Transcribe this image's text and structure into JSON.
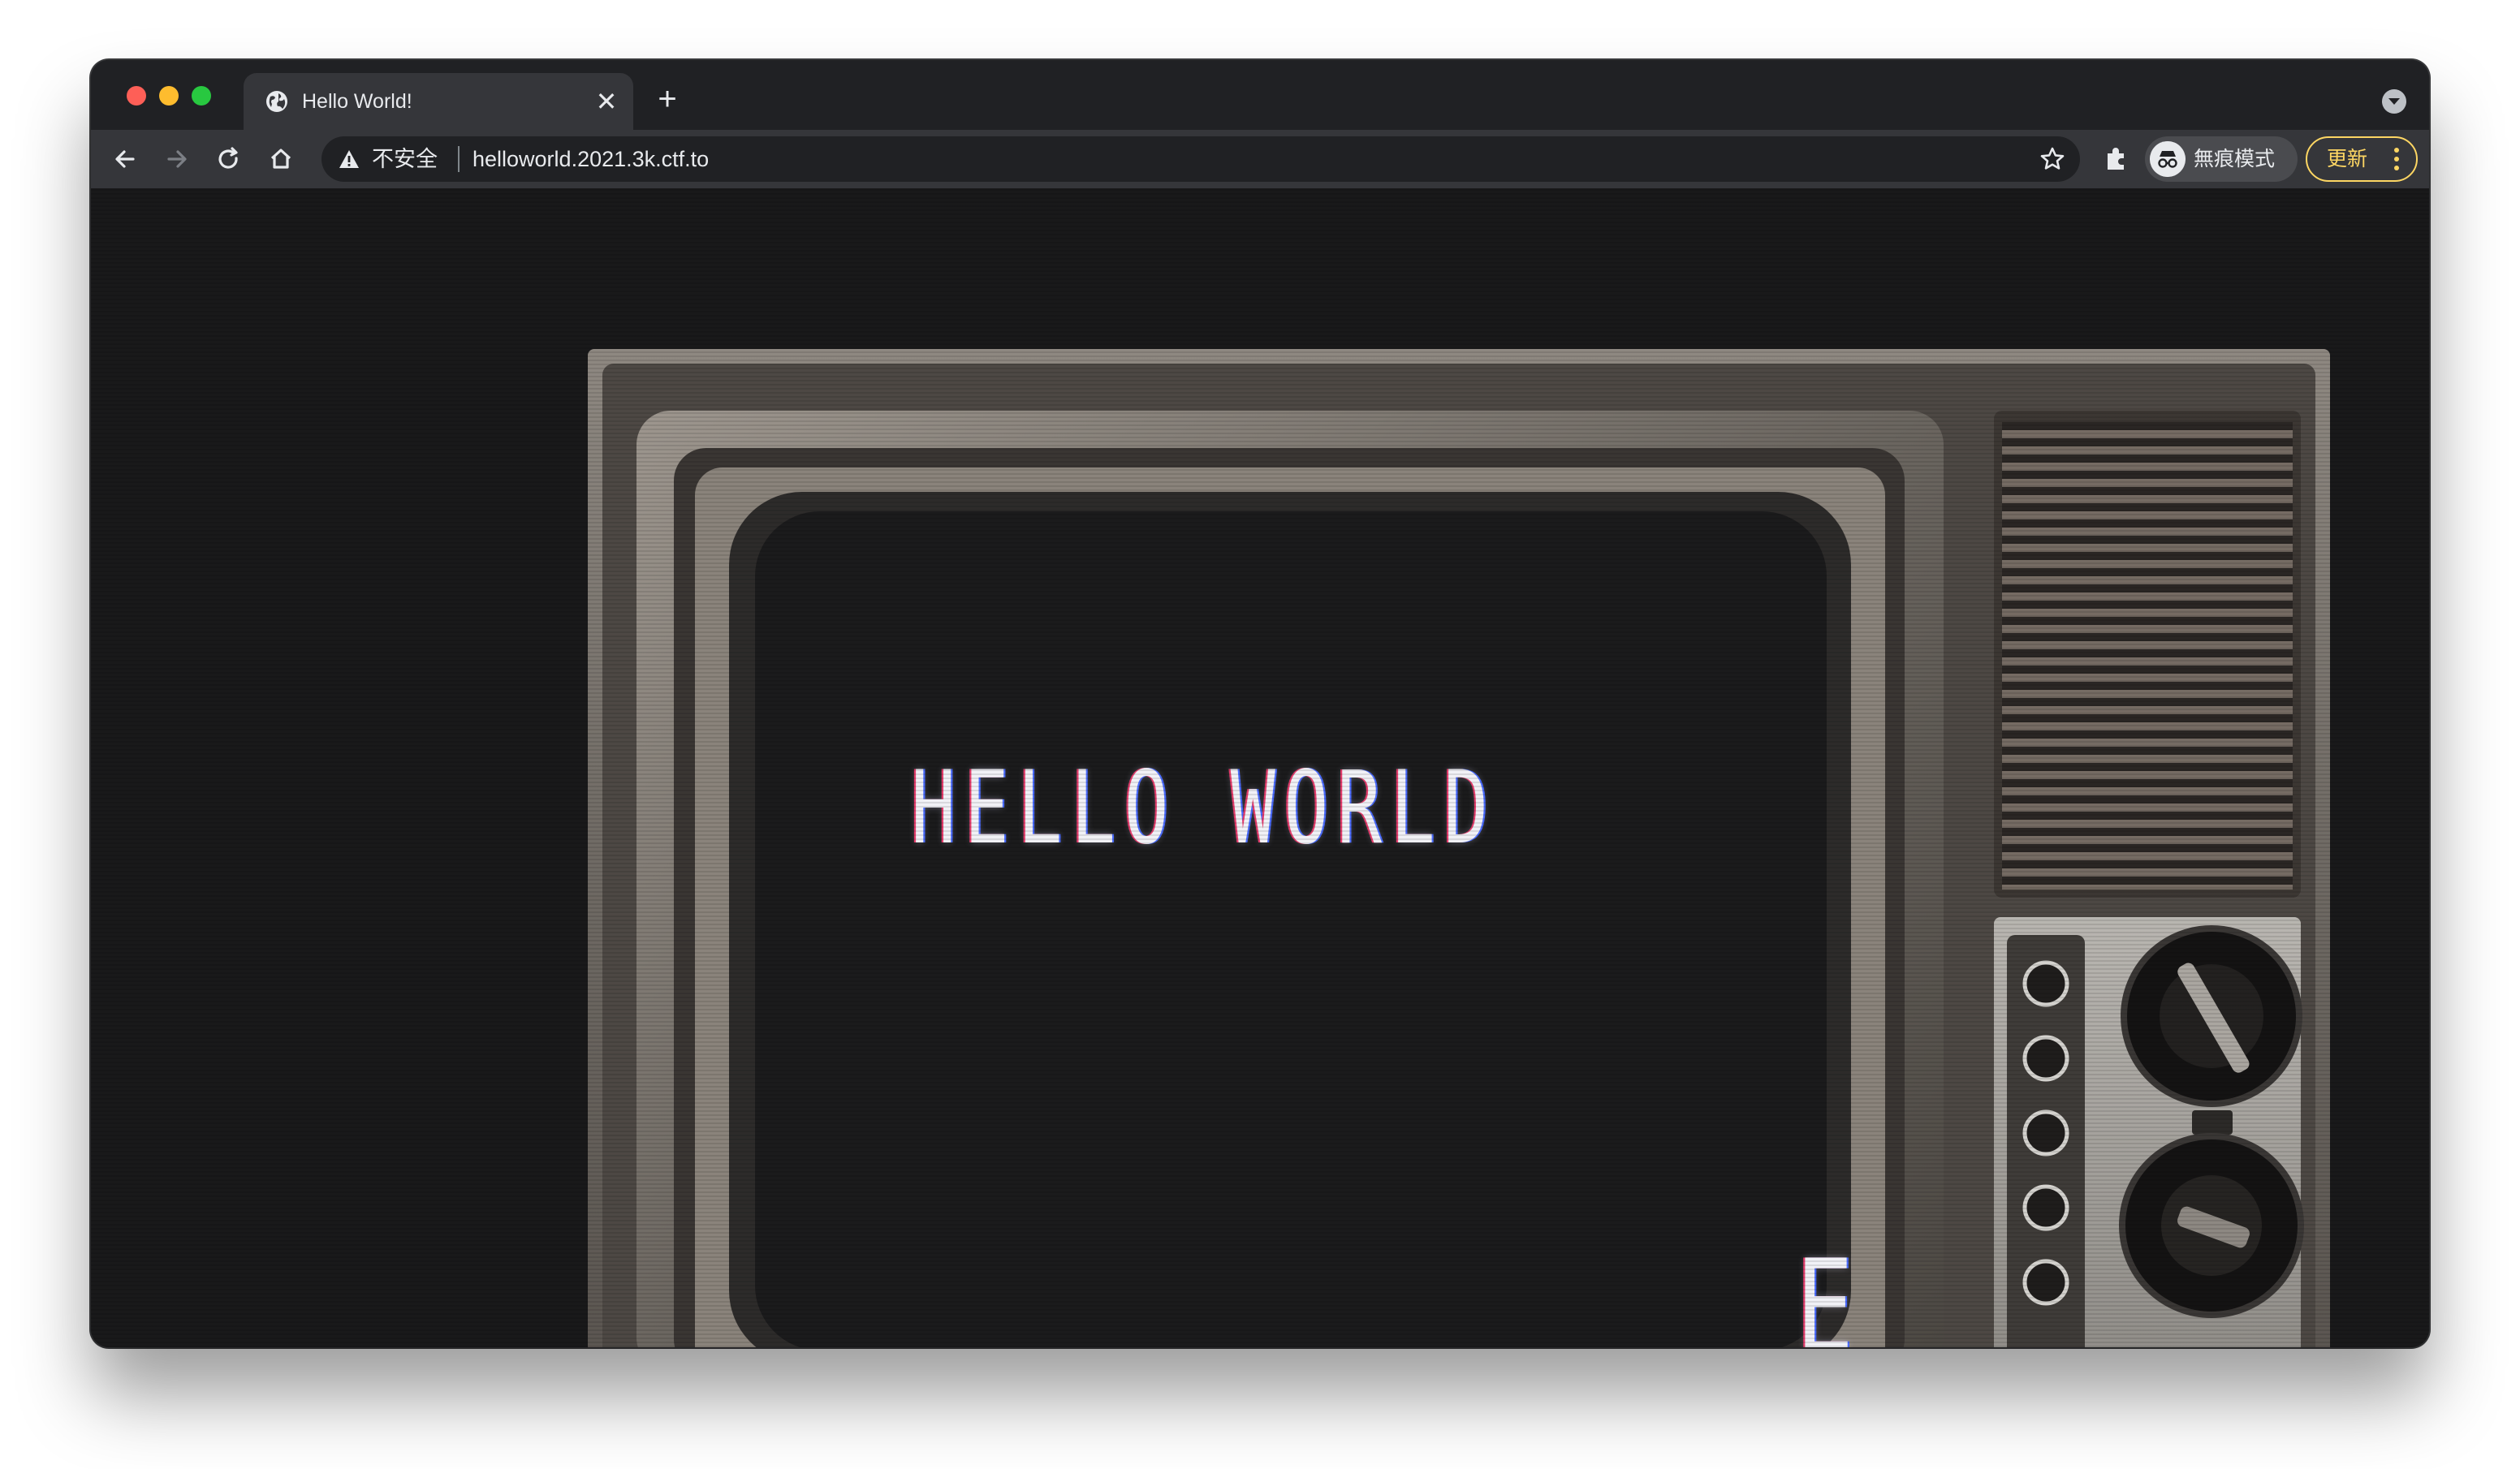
{
  "window": {
    "tab": {
      "title": "Hello World!",
      "icon": "globe-icon",
      "close_glyph": "✕"
    },
    "new_tab_glyph": "+"
  },
  "toolbar": {
    "security_label": "不安全",
    "url": "helloworld.2021.3k.ctf.to",
    "profile_label": "無痕模式",
    "update_label": "更新"
  },
  "page": {
    "screen_text": "HELLO WORLD",
    "screen_letter": "E"
  },
  "colors": {
    "titlebar": "#202124",
    "toolbar": "#35363a",
    "omnibox": "#202124",
    "page_background": "#19191a",
    "update_accent": "#fdd663"
  }
}
